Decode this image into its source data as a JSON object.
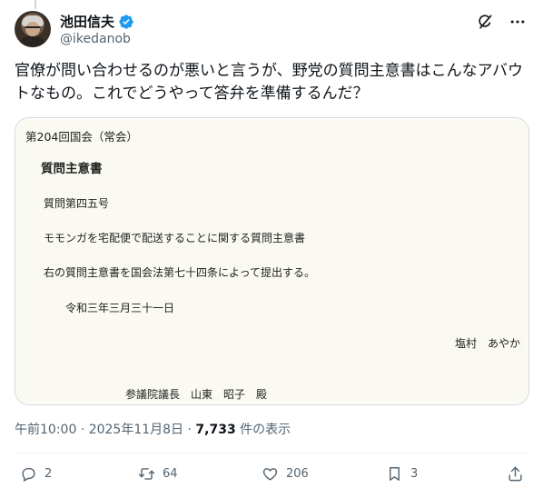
{
  "author": {
    "name": "池田信夫",
    "handle": "@ikedanob"
  },
  "tweet": {
    "text": "官僚が問い合わせるのが悪いと言うが、野党の質問主意書はこんなアバウトなもの。これでどうやって答弁を準備するんだ？"
  },
  "document": {
    "session": "第204回国会（常会）",
    "title": "質問主意書",
    "number": "質問第四五号",
    "subject": "モモンガを宅配便で配送することに関する質問主意書",
    "statement": "右の質問主意書を国会法第七十四条によって提出する。",
    "date": "令和三年三月三十一日",
    "submitter": "塩村　あやか",
    "addressee": "参議院議長　山東　昭子　殿"
  },
  "meta": {
    "time_date": "午前10:00 · 2025年11月8日 · ",
    "views_count": "7,733",
    "views_suffix": " 件の表示"
  },
  "actions": {
    "replies": "2",
    "reposts": "64",
    "likes": "206",
    "bookmarks": "3"
  },
  "colors": {
    "verified": "#1d9bf0",
    "secondary_text": "#536471",
    "document_background": "#fbfaf2"
  },
  "icons": [
    "verified-badge-icon",
    "grok-icon",
    "more-icon",
    "reply-icon",
    "repost-icon",
    "like-icon",
    "bookmark-icon",
    "share-icon"
  ]
}
